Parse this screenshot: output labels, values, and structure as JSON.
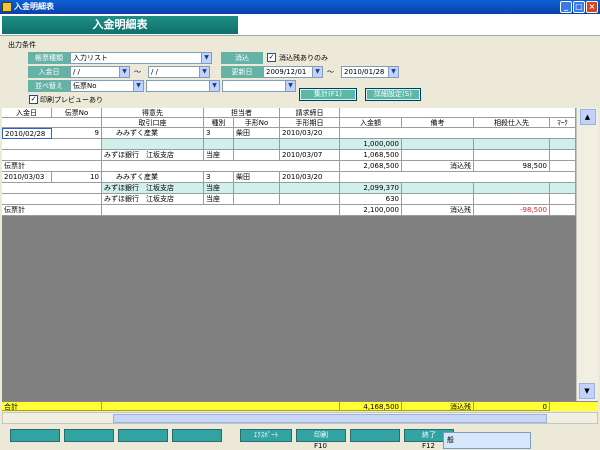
{
  "window": {
    "title": "入金明細表",
    "header_title": "入金明細表"
  },
  "conditions": {
    "section_label": "出力条件",
    "form_type_label": "帳票種類",
    "form_type_value": "入力リスト",
    "deposit_date_label": "入金日",
    "deposit_from": " /  /",
    "deposit_to": " /  /",
    "sort_label": "並べ替え",
    "sort_value": "伝票No",
    "sort2_value": "",
    "sort3_value": "",
    "settled_label": "消込",
    "settled_only_label": "消込残ありのみ",
    "updated_label": "更新日",
    "updated_from": "2009/12/01",
    "updated_to": "2010/01/28",
    "tilde": "～",
    "preview_label": "印刷プレビューあり",
    "aggregate_button": "集計(F1)",
    "detail_button": "詳細設定(S)"
  },
  "grid": {
    "headers_top": [
      "入金日",
      "伝票No",
      "得意先",
      "担当者",
      "請求締日"
    ],
    "headers_bottom": [
      "取引口座",
      "種別",
      "手形No",
      "手形期日",
      "入金額",
      "備考",
      "相殺仕入先",
      "ﾏｰｸ"
    ],
    "rows": [
      {
        "date": "2010/02/28",
        "no": "9",
        "customer": "みみずく産業",
        "type": "3",
        "person": "柴田",
        "bill_date": "2010/03/20"
      },
      {
        "amount": "1,000,000"
      },
      {
        "account": "みずほ銀行　江坂支店",
        "type": "当座",
        "due": "2010/03/07",
        "amount": "1,068,500"
      },
      {
        "label": "伝票計",
        "amount": "2,068,500",
        "remark": "消込残",
        "offset": "98,500"
      },
      {
        "date": "2010/03/03",
        "no": "10",
        "customer": "みみずく産業",
        "type": "3",
        "person": "柴田",
        "bill_date": "2010/03/20"
      },
      {
        "account": "みずほ銀行　江坂支店",
        "type": "当座",
        "amount": "2,099,370"
      },
      {
        "account": "みずほ銀行　江坂支店",
        "type": "当座",
        "amount": "630"
      },
      {
        "label": "伝票計",
        "amount": "2,100,000",
        "remark": "消込残",
        "offset": "-98,500"
      }
    ]
  },
  "totals": {
    "label": "合計",
    "amount": "4,168,500",
    "remark": "消込残",
    "offset": "0"
  },
  "fbar": {
    "export_label": "ｴｸｽﾎﾟｰﾄ",
    "print_label": "印刷",
    "print_key": "F10",
    "exit_label": "終了",
    "exit_key": "F12"
  },
  "ime": {
    "text": "般"
  },
  "colors": {
    "accent": "#30a3a2",
    "row_tint": "#d1f0ec",
    "negative": "#e0252f",
    "total_bg": "#ffff33"
  }
}
